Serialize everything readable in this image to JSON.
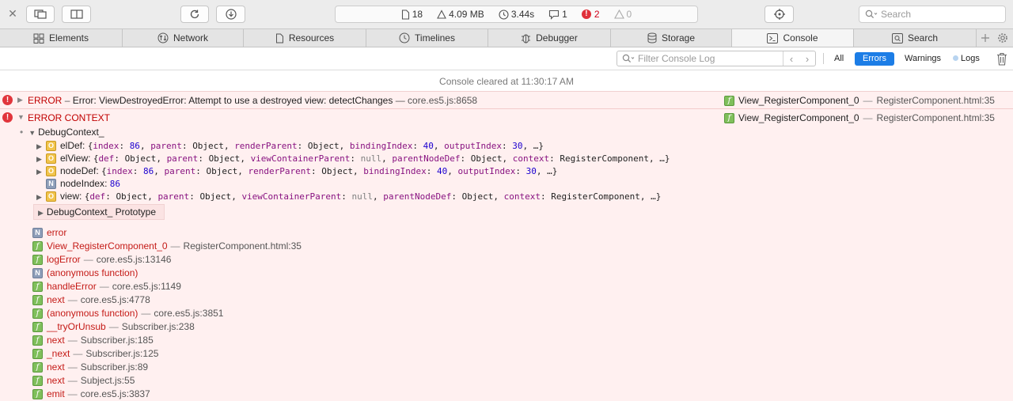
{
  "toolbar": {
    "close_icon": "close-icon",
    "dashboard": {
      "resources": "18",
      "size": "4.09 MB",
      "time": "3.44s",
      "logs": "1",
      "errors": "2",
      "warnings": "0"
    },
    "search_placeholder": "Search"
  },
  "tabs": [
    {
      "label": "Elements",
      "icon": "elements-icon"
    },
    {
      "label": "Network",
      "icon": "network-icon"
    },
    {
      "label": "Resources",
      "icon": "resources-icon"
    },
    {
      "label": "Timelines",
      "icon": "timelines-icon"
    },
    {
      "label": "Debugger",
      "icon": "debugger-icon"
    },
    {
      "label": "Storage",
      "icon": "storage-icon"
    },
    {
      "label": "Console",
      "icon": "console-icon",
      "active": true
    },
    {
      "label": "Search",
      "icon": "search-icon"
    }
  ],
  "filter": {
    "placeholder": "Filter Console Log",
    "all": "All",
    "errors": "Errors",
    "warnings": "Warnings",
    "logs": "Logs"
  },
  "console": {
    "cleared": "Console cleared at 11:30:17 AM",
    "error1": {
      "label": "ERROR",
      "dash": "–",
      "message": "Error: ViewDestroyedError: Attempt to use a destroyed view: detectChanges",
      "sep": "—",
      "location": "core.es5.js:8658",
      "source_fn": "View_RegisterComponent_0",
      "source_sep": "—",
      "source_file": "RegisterComponent.html:35"
    },
    "error2": {
      "label": "ERROR CONTEXT",
      "source_fn": "View_RegisterComponent_0",
      "source_sep": "—",
      "source_file": "RegisterComponent.html:35"
    },
    "context": {
      "head": "DebugContext_",
      "props": [
        {
          "key": "elDef",
          "colon": ": ",
          "kind": "object"
        },
        {
          "key": "elView",
          "colon": ": ",
          "kind": "object"
        },
        {
          "key": "nodeDef",
          "colon": ": ",
          "kind": "object"
        },
        {
          "key": "nodeIndex",
          "colon": ": ",
          "kind": "number",
          "value": "86"
        },
        {
          "key": "view",
          "colon": ": ",
          "kind": "object"
        }
      ],
      "prototype": "DebugContext_ Prototype"
    },
    "eldef_preview": {
      "open": "{",
      "k1": "index",
      "v1": "86",
      "k2": "parent",
      "v2": "Object",
      "k3": "renderParent",
      "v3": "Object",
      "k4": "bindingIndex",
      "v4": "40",
      "k5": "outputIndex",
      "v5": "30",
      "tail": "…}"
    },
    "elview_preview": {
      "open": "{",
      "k1": "def",
      "v1": "Object",
      "k2": "parent",
      "v2": "Object",
      "k3": "viewContainerParent",
      "v3": "null",
      "k4": "parentNodeDef",
      "v4": "Object",
      "k5": "context",
      "v5": "RegisterComponent",
      "tail": "…}"
    },
    "nodedef_preview": {
      "open": "{",
      "k1": "index",
      "v1": "86",
      "k2": "parent",
      "v2": "Object",
      "k3": "renderParent",
      "v3": "Object",
      "k4": "bindingIndex",
      "v4": "40",
      "k5": "outputIndex",
      "v5": "30",
      "tail": "…}"
    },
    "view_preview": {
      "open": "{",
      "k1": "def",
      "v1": "Object",
      "k2": "parent",
      "v2": "Object",
      "k3": "viewContainerParent",
      "v3": "null",
      "k4": "parentNodeDef",
      "v4": "Object",
      "k5": "context",
      "v5": "RegisterComponent",
      "tail": "…}"
    },
    "stack": [
      {
        "icon": "N",
        "fn": "error",
        "file": ""
      },
      {
        "icon": "f",
        "fn": "View_RegisterComponent_0",
        "file": "RegisterComponent.html:35"
      },
      {
        "icon": "f",
        "fn": "logError",
        "file": "core.es5.js:13146"
      },
      {
        "icon": "N",
        "fn": "(anonymous function)",
        "file": ""
      },
      {
        "icon": "f",
        "fn": "handleError",
        "file": "core.es5.js:1149"
      },
      {
        "icon": "f",
        "fn": "next",
        "file": "core.es5.js:4778"
      },
      {
        "icon": "f",
        "fn": "(anonymous function)",
        "file": "core.es5.js:3851"
      },
      {
        "icon": "f",
        "fn": "__tryOrUnsub",
        "file": "Subscriber.js:238"
      },
      {
        "icon": "f",
        "fn": "next",
        "file": "Subscriber.js:185"
      },
      {
        "icon": "f",
        "fn": "_next",
        "file": "Subscriber.js:125"
      },
      {
        "icon": "f",
        "fn": "next",
        "file": "Subscriber.js:89"
      },
      {
        "icon": "f",
        "fn": "next",
        "file": "Subject.js:55"
      },
      {
        "icon": "f",
        "fn": "emit",
        "file": "core.es5.js:3837"
      }
    ],
    "stack_sep": "—"
  }
}
